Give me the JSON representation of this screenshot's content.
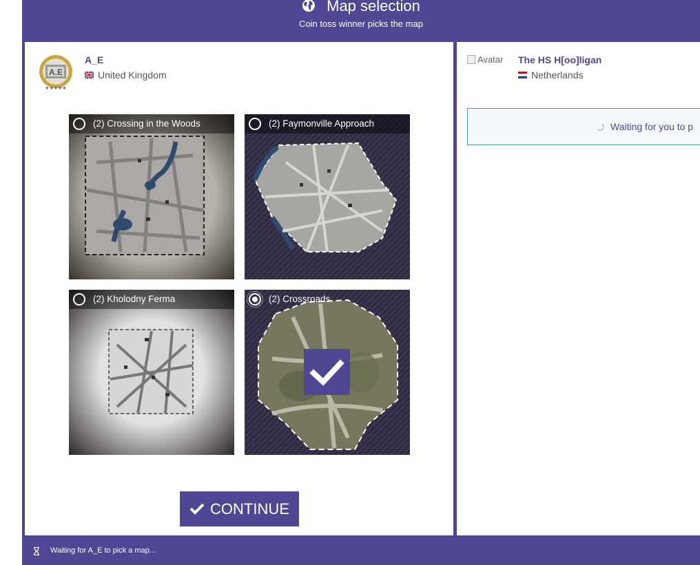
{
  "header": {
    "title": "Map selection",
    "subtitle": "Coin toss winner picks the map",
    "icon": "globe-icon"
  },
  "player_left": {
    "name": "A_E",
    "country": "United Kingdom",
    "flag": "uk-flag-icon"
  },
  "player_right": {
    "avatar_alt": "Avatar",
    "name": "The HS H[oo]ligan",
    "country": "Netherlands",
    "flag": "netherlands-flag-icon"
  },
  "maps": [
    {
      "label": "(2) Crossing in the Woods",
      "selected": false
    },
    {
      "label": "(2) Faymonville Approach",
      "selected": false
    },
    {
      "label": "(2) Kholodny Ferma",
      "selected": false
    },
    {
      "label": "(2) Crossroads",
      "selected": true
    }
  ],
  "continue_label": "CONTINUE",
  "waiting_right": "Waiting for you to p",
  "footer_status": "Waiting for A_E to pick a map...",
  "colors": {
    "accent": "#4f4694",
    "info_border": "#4a9ab2"
  }
}
